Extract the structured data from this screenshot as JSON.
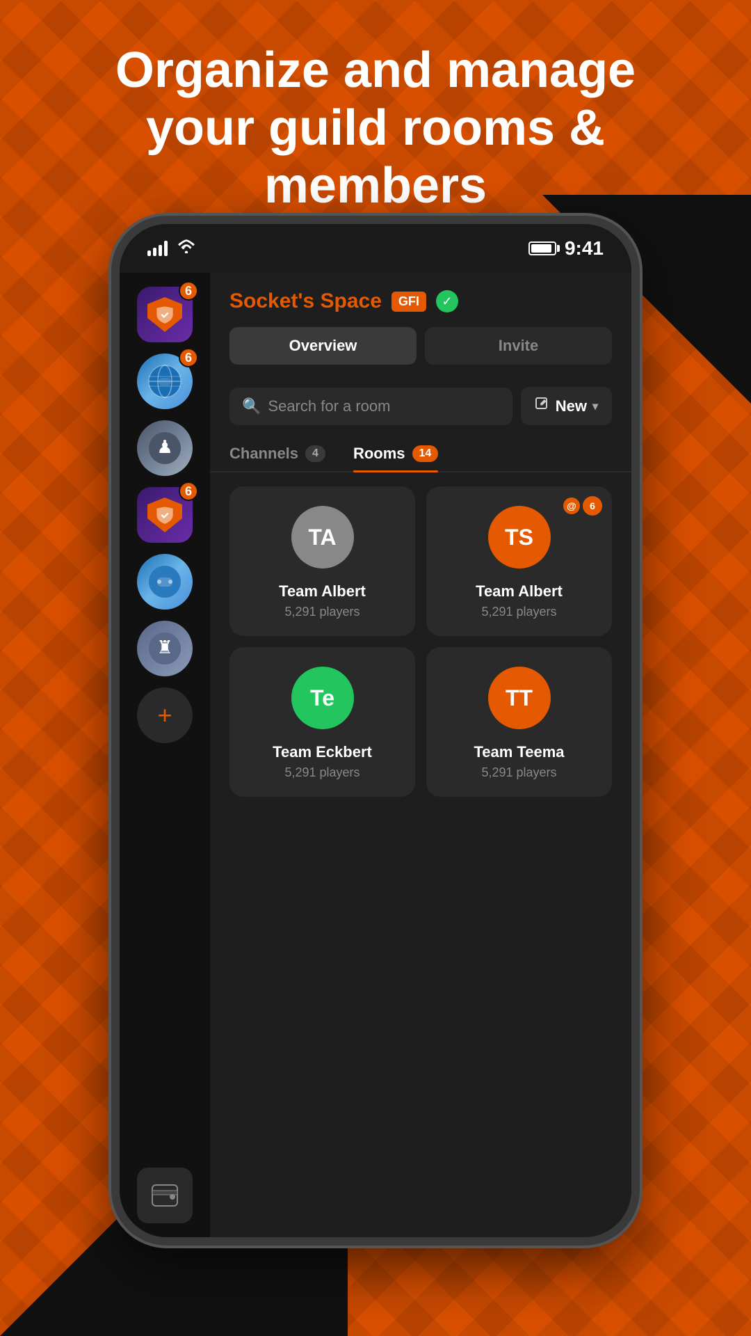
{
  "hero": {
    "title": "Organize and manage your guild rooms & members"
  },
  "status_bar": {
    "time": "9:41",
    "battery_level": "90"
  },
  "sidebar": {
    "avatars": [
      {
        "id": "guild1",
        "type": "shield",
        "badge": "6"
      },
      {
        "id": "globe1",
        "type": "globe",
        "badge": "6"
      },
      {
        "id": "chess1",
        "type": "chess",
        "badge": ""
      },
      {
        "id": "guild2",
        "type": "shield",
        "badge": "6"
      },
      {
        "id": "globe2",
        "type": "globe",
        "badge": ""
      },
      {
        "id": "chess2",
        "type": "chess",
        "badge": ""
      }
    ],
    "add_button_label": "+",
    "wallet_button_label": "wallet"
  },
  "header": {
    "guild_name": "Socket's Space",
    "badge_label": "GFI",
    "verified": true,
    "tabs": [
      {
        "id": "overview",
        "label": "Overview",
        "active": true
      },
      {
        "id": "invite",
        "label": "Invite",
        "active": false
      }
    ]
  },
  "search": {
    "placeholder": "Search for a room",
    "new_button_label": "New"
  },
  "filter_tabs": [
    {
      "id": "channels",
      "label": "Channels",
      "count": "4",
      "active": false
    },
    {
      "id": "rooms",
      "label": "Rooms",
      "count": "14",
      "active": true
    }
  ],
  "rooms": [
    {
      "id": "room1",
      "initials": "TA",
      "name": "Team Albert",
      "players": "5,291 players",
      "color": "grey",
      "notification": false
    },
    {
      "id": "room2",
      "initials": "TS",
      "name": "Team Albert",
      "players": "5,291 players",
      "color": "orange",
      "notification": true,
      "notif_count": "6"
    },
    {
      "id": "room3",
      "initials": "Te",
      "name": "Team Eckbert",
      "players": "5,291 players",
      "color": "green",
      "notification": false
    },
    {
      "id": "room4",
      "initials": "TT",
      "name": "Team Teema",
      "players": "5,291 players",
      "color": "red",
      "notification": false
    }
  ],
  "colors": {
    "accent": "#e55a00",
    "background": "#1a1a1a",
    "card_bg": "#2a2a2a",
    "verified_green": "#22c55e"
  }
}
